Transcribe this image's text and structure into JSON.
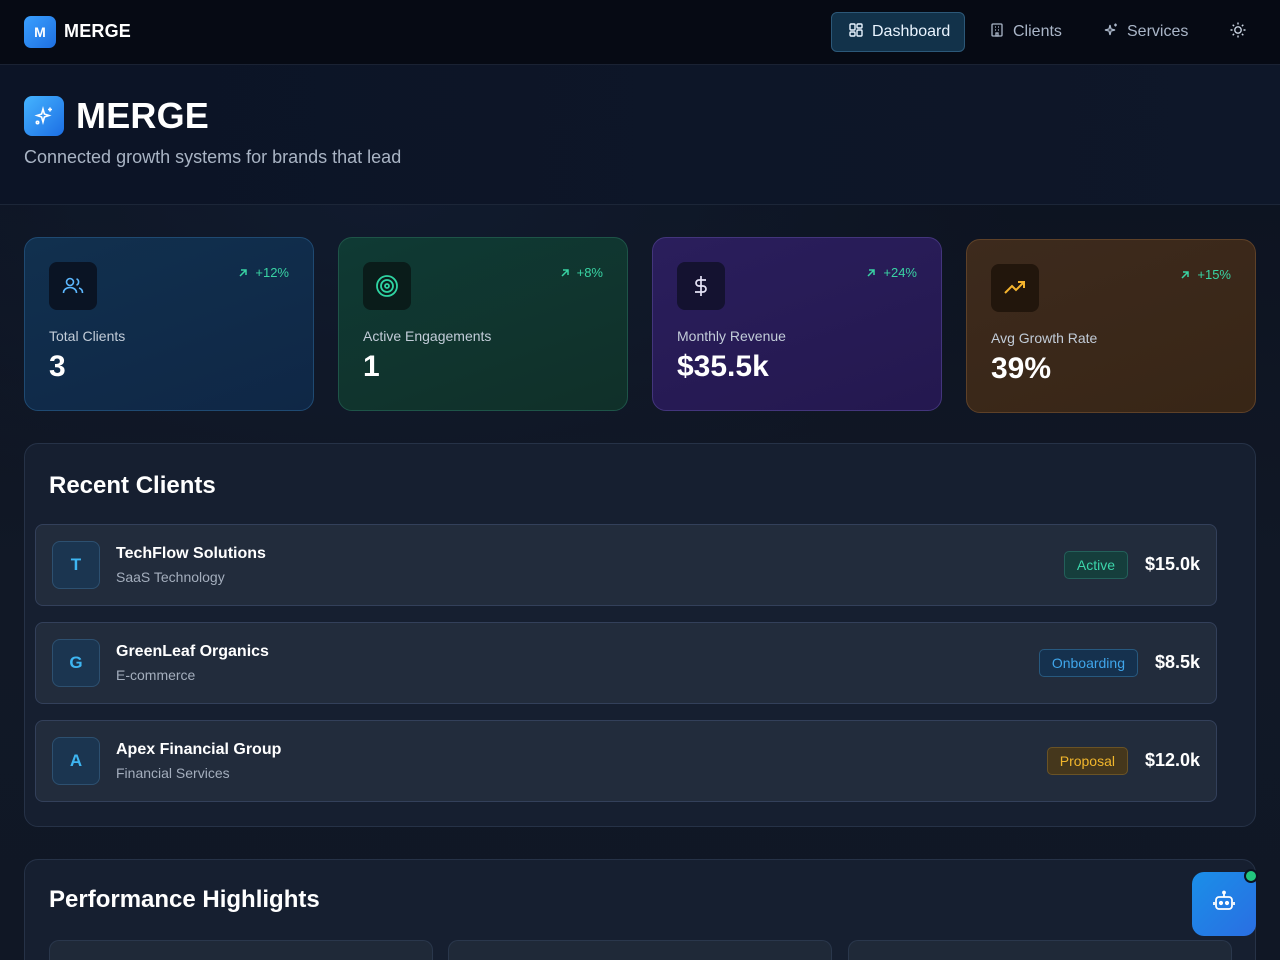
{
  "brand": {
    "logo_letter": "M",
    "name": "MERGE"
  },
  "nav": {
    "items": [
      {
        "label": "Dashboard",
        "icon": "dashboard-icon",
        "active": true
      },
      {
        "label": "Clients",
        "icon": "building-icon",
        "active": false
      },
      {
        "label": "Services",
        "icon": "sparkles-icon",
        "active": false
      }
    ],
    "theme_toggle_icon": "sun-icon"
  },
  "hero": {
    "title": "MERGE",
    "subtitle": "Connected growth systems for brands that lead",
    "icon": "sparkles-icon"
  },
  "stats": [
    {
      "label": "Total Clients",
      "value": "3",
      "change": "+12%",
      "icon": "users-icon",
      "color": "#1f4a72"
    },
    {
      "label": "Active Engagements",
      "value": "1",
      "change": "+8%",
      "icon": "target-icon",
      "color": "#1e5448"
    },
    {
      "label": "Monthly Revenue",
      "value": "$35.5k",
      "change": "+24%",
      "icon": "dollar-icon",
      "color": "#43357c"
    },
    {
      "label": "Avg Growth Rate",
      "value": "39%",
      "change": "+15%",
      "icon": "trending-up-icon",
      "color": "#5e4128"
    }
  ],
  "recent_clients": {
    "title": "Recent Clients",
    "rows": [
      {
        "initial": "T",
        "name": "TechFlow Solutions",
        "industry": "SaaS Technology",
        "status": "Active",
        "amount": "$15.0k"
      },
      {
        "initial": "G",
        "name": "GreenLeaf Organics",
        "industry": "E-commerce",
        "status": "Onboarding",
        "amount": "$8.5k"
      },
      {
        "initial": "A",
        "name": "Apex Financial Group",
        "industry": "Financial Services",
        "status": "Proposal",
        "amount": "$12.0k"
      }
    ]
  },
  "performance": {
    "title": "Performance Highlights"
  },
  "colors": {
    "accent": "#1e6fe0",
    "positive": "#39d3a3",
    "status_active": "#3bd5aa",
    "status_onboarding": "#3fa5ea",
    "status_proposal": "#f1b62c",
    "online_dot": "#22c77e"
  },
  "assistant": {
    "icon": "bot-icon",
    "online": true
  }
}
